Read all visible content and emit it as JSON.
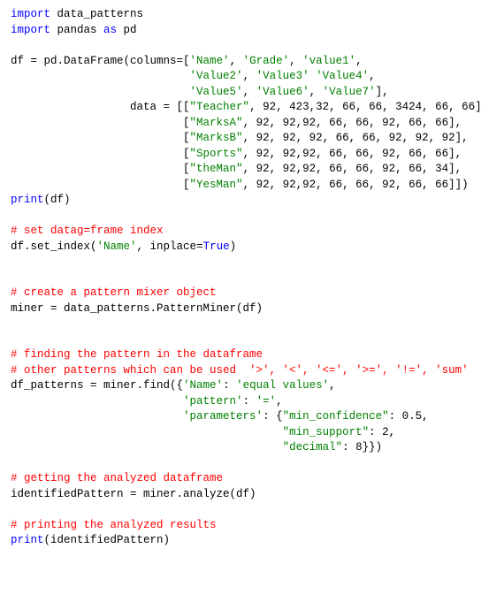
{
  "lines": [
    {
      "t": [
        {
          "c": "kw",
          "s": "import"
        },
        {
          "c": "id",
          "s": " data_patterns"
        }
      ]
    },
    {
      "t": [
        {
          "c": "kw",
          "s": "import"
        },
        {
          "c": "id",
          "s": " pandas "
        },
        {
          "c": "kw",
          "s": "as"
        },
        {
          "c": "id",
          "s": " pd"
        }
      ]
    },
    {
      "t": []
    },
    {
      "t": [
        {
          "c": "id",
          "s": "df = pd.DataFrame(columns=["
        },
        {
          "c": "str",
          "s": "'Name'"
        },
        {
          "c": "id",
          "s": ", "
        },
        {
          "c": "str",
          "s": "'Grade'"
        },
        {
          "c": "id",
          "s": ", "
        },
        {
          "c": "str",
          "s": "'value1'"
        },
        {
          "c": "id",
          "s": ","
        }
      ]
    },
    {
      "t": [
        {
          "c": "id",
          "s": "                           "
        },
        {
          "c": "str",
          "s": "'Value2'"
        },
        {
          "c": "id",
          "s": ", "
        },
        {
          "c": "str",
          "s": "'Value3'"
        },
        {
          "c": "id",
          "s": " "
        },
        {
          "c": "str",
          "s": "'Value4'"
        },
        {
          "c": "id",
          "s": ","
        }
      ]
    },
    {
      "t": [
        {
          "c": "id",
          "s": "                           "
        },
        {
          "c": "str",
          "s": "'Value5'"
        },
        {
          "c": "id",
          "s": ", "
        },
        {
          "c": "str",
          "s": "'Value6'"
        },
        {
          "c": "id",
          "s": ", "
        },
        {
          "c": "str",
          "s": "'Value7'"
        },
        {
          "c": "id",
          "s": "],"
        }
      ]
    },
    {
      "t": [
        {
          "c": "id",
          "s": "                  data = [["
        },
        {
          "c": "str",
          "s": "\"Teacher\""
        },
        {
          "c": "id",
          "s": ", 92, 423,32, 66, 66, 3424, 66, 66]"
        }
      ]
    },
    {
      "t": [
        {
          "c": "id",
          "s": "                          ["
        },
        {
          "c": "str",
          "s": "\"MarksA\""
        },
        {
          "c": "id",
          "s": ", 92, 92,92, 66, 66, 92, 66, 66],"
        }
      ]
    },
    {
      "t": [
        {
          "c": "id",
          "s": "                          ["
        },
        {
          "c": "str",
          "s": "\"MarksB\""
        },
        {
          "c": "id",
          "s": ", 92, 92, 92, 66, 66, 92, 92, 92],"
        }
      ]
    },
    {
      "t": [
        {
          "c": "id",
          "s": "                          ["
        },
        {
          "c": "str",
          "s": "\"Sports\""
        },
        {
          "c": "id",
          "s": ", 92, 92,92, 66, 66, 92, 66, 66],"
        }
      ]
    },
    {
      "t": [
        {
          "c": "id",
          "s": "                          ["
        },
        {
          "c": "str",
          "s": "\"theMan\""
        },
        {
          "c": "id",
          "s": ", 92, 92,92, 66, 66, 92, 66, 34],"
        }
      ]
    },
    {
      "t": [
        {
          "c": "id",
          "s": "                          ["
        },
        {
          "c": "str",
          "s": "\"YesMan\""
        },
        {
          "c": "id",
          "s": ", 92, 92,92, 66, 66, 92, 66, 66]])"
        }
      ]
    },
    {
      "t": [
        {
          "c": "kw",
          "s": "print"
        },
        {
          "c": "id",
          "s": "(df)"
        }
      ]
    },
    {
      "t": []
    },
    {
      "t": [
        {
          "c": "cmt",
          "s": "# set datag=frame index"
        }
      ]
    },
    {
      "t": [
        {
          "c": "id",
          "s": "df.set_index("
        },
        {
          "c": "str",
          "s": "'Name'"
        },
        {
          "c": "id",
          "s": ", inplace="
        },
        {
          "c": "boolkw",
          "s": "True"
        },
        {
          "c": "id",
          "s": ")"
        }
      ]
    },
    {
      "t": []
    },
    {
      "t": []
    },
    {
      "t": [
        {
          "c": "cmt",
          "s": "# create a pattern mixer object"
        }
      ]
    },
    {
      "t": [
        {
          "c": "id",
          "s": "miner = data_patterns.PatternMiner(df)"
        }
      ]
    },
    {
      "t": []
    },
    {
      "t": []
    },
    {
      "t": [
        {
          "c": "cmt",
          "s": "# finding the pattern in the dataframe"
        }
      ]
    },
    {
      "t": [
        {
          "c": "cmt",
          "s": "# other patterns which can be used  '>', '<', '<=', '>=', '!=', 'sum'"
        }
      ]
    },
    {
      "t": [
        {
          "c": "id",
          "s": "df_patterns = miner.find({"
        },
        {
          "c": "str",
          "s": "'Name'"
        },
        {
          "c": "id",
          "s": ": "
        },
        {
          "c": "str",
          "s": "'equal values'"
        },
        {
          "c": "id",
          "s": ","
        }
      ]
    },
    {
      "t": [
        {
          "c": "id",
          "s": "                          "
        },
        {
          "c": "str",
          "s": "'pattern'"
        },
        {
          "c": "id",
          "s": ": "
        },
        {
          "c": "str",
          "s": "'='"
        },
        {
          "c": "id",
          "s": ","
        }
      ]
    },
    {
      "t": [
        {
          "c": "id",
          "s": "                          "
        },
        {
          "c": "str",
          "s": "'parameters'"
        },
        {
          "c": "id",
          "s": ": {"
        },
        {
          "c": "str",
          "s": "\"min_confidence\""
        },
        {
          "c": "id",
          "s": ": 0.5,"
        }
      ]
    },
    {
      "t": [
        {
          "c": "id",
          "s": "                                         "
        },
        {
          "c": "str",
          "s": "\"min_support\""
        },
        {
          "c": "id",
          "s": ": 2,"
        }
      ]
    },
    {
      "t": [
        {
          "c": "id",
          "s": "                                         "
        },
        {
          "c": "str",
          "s": "\"decimal\""
        },
        {
          "c": "id",
          "s": ": 8}})"
        }
      ]
    },
    {
      "t": []
    },
    {
      "t": [
        {
          "c": "cmt",
          "s": "# getting the analyzed dataframe"
        }
      ]
    },
    {
      "t": [
        {
          "c": "id",
          "s": "identifiedPattern = miner.analyze(df)"
        }
      ]
    },
    {
      "t": []
    },
    {
      "t": [
        {
          "c": "cmt",
          "s": "# printing the analyzed results"
        }
      ]
    },
    {
      "t": [
        {
          "c": "kw",
          "s": "print"
        },
        {
          "c": "id",
          "s": "(identifiedPattern)"
        }
      ]
    }
  ]
}
